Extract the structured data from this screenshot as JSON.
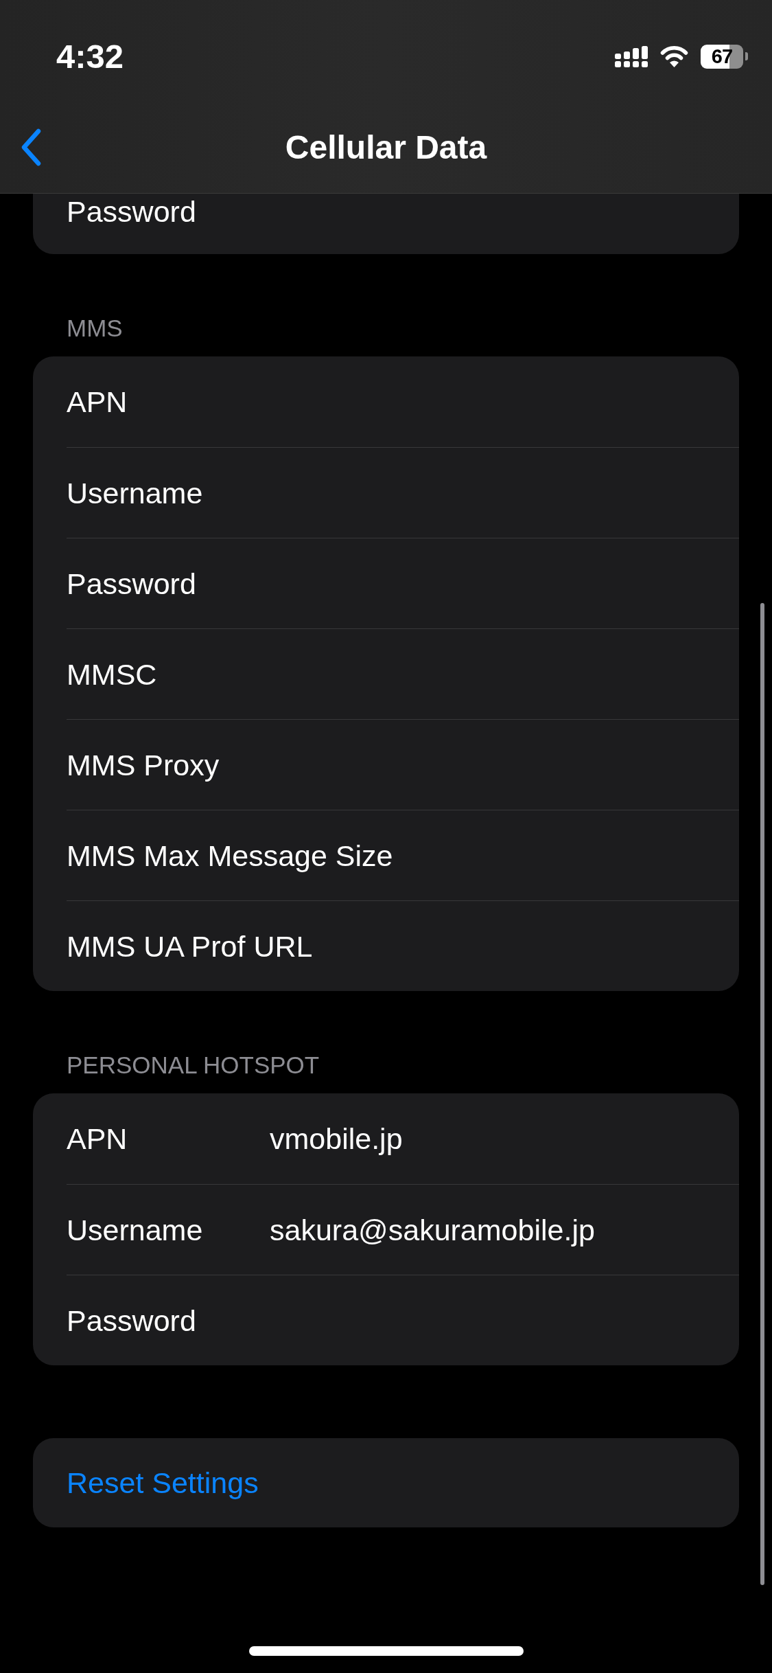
{
  "status_bar": {
    "time": "4:32",
    "battery": "67"
  },
  "nav_bar": {
    "title": "Cellular Data"
  },
  "sections": [
    {
      "kind": "cut",
      "rows": [
        {
          "label": "Password"
        }
      ]
    },
    {
      "kind": "group",
      "header": "MMS",
      "rows": [
        {
          "label": "APN"
        },
        {
          "label": "Username"
        },
        {
          "label": "Password"
        },
        {
          "label": "MMSC"
        },
        {
          "label": "MMS Proxy"
        },
        {
          "label": "MMS Max Message Size"
        },
        {
          "label": "MMS UA Prof URL"
        }
      ]
    },
    {
      "kind": "group",
      "header": "PERSONAL HOTSPOT",
      "rows": [
        {
          "label": "APN",
          "value": "vmobile.jp"
        },
        {
          "label": "Username",
          "value": "sakura@sakuramobile.jp"
        },
        {
          "label": "Password"
        }
      ]
    },
    {
      "kind": "action",
      "rows": [
        {
          "label": "Reset Settings"
        }
      ]
    }
  ]
}
